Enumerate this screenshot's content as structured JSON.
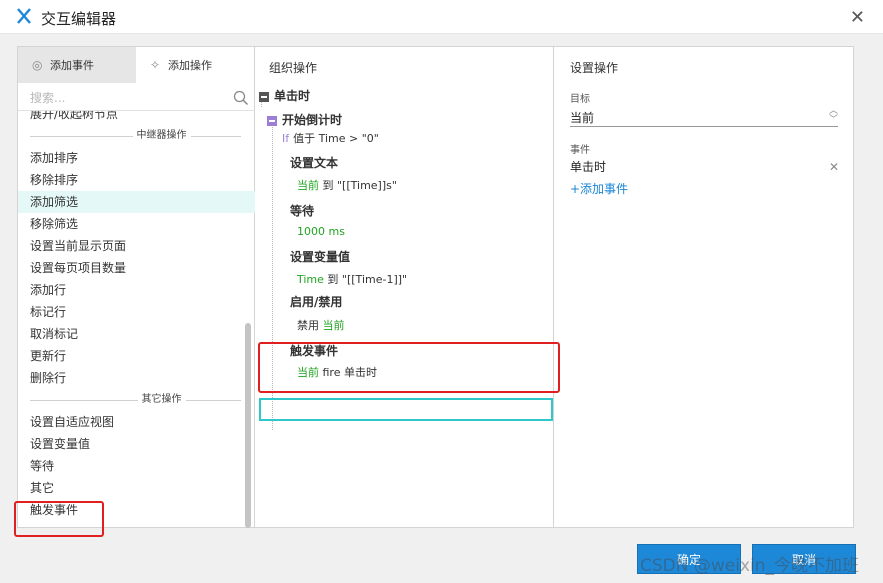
{
  "window": {
    "title": "交互编辑器"
  },
  "left": {
    "tabs": [
      {
        "label": "添加事件",
        "icon": "event-icon"
      },
      {
        "label": "添加操作",
        "icon": "sparkle-icon"
      }
    ],
    "search_placeholder": "搜索...",
    "items_top": [
      "展开/收起树节点"
    ],
    "section_repeater": "中继器操作",
    "repeater_items": [
      "添加排序",
      "移除排序",
      "添加筛选",
      "移除筛选",
      "设置当前显示页面",
      "设置每页项目数量",
      "添加行",
      "标记行",
      "取消标记",
      "更新行",
      "删除行"
    ],
    "section_other": "其它操作",
    "other_items": [
      "设置自适应视图",
      "设置变量值",
      "等待",
      "其它",
      "触发事件"
    ]
  },
  "middle": {
    "header": "组织操作",
    "event": "单击时",
    "case": "开始倒计时",
    "condition_if": "If",
    "condition_text": "值于 Time > \"0\"",
    "actions": [
      {
        "title": "设置文本",
        "target": "当前",
        "detail": " 到 \"[[Time]]s\""
      },
      {
        "title": "等待",
        "target": "1000 ms",
        "detail": ""
      },
      {
        "title": "设置变量值",
        "target": "Time",
        "detail": " 到 \"[[Time-1]]\""
      },
      {
        "title": "启用/禁用",
        "prefix": "禁用 ",
        "target": "当前",
        "detail": ""
      },
      {
        "title": "触发事件",
        "target": "当前",
        "detail": " fire 单击时"
      }
    ]
  },
  "right": {
    "header": "设置操作",
    "target_label": "目标",
    "target_value": "当前",
    "event_label": "事件",
    "event_value": "单击时",
    "delete_icon": "close-icon",
    "add_event": "+添加事件"
  },
  "footer": {
    "ok": "确定",
    "cancel": "取消"
  },
  "watermark": "CSDN @weixin_今晚不加班",
  "colors": {
    "accent": "#1e88d8",
    "selection": "#e5f8f8",
    "highlight": "#2fc8c8",
    "annotation": "#e02020",
    "case_purple": "#9b7fd6",
    "target_green": "#21a321"
  }
}
